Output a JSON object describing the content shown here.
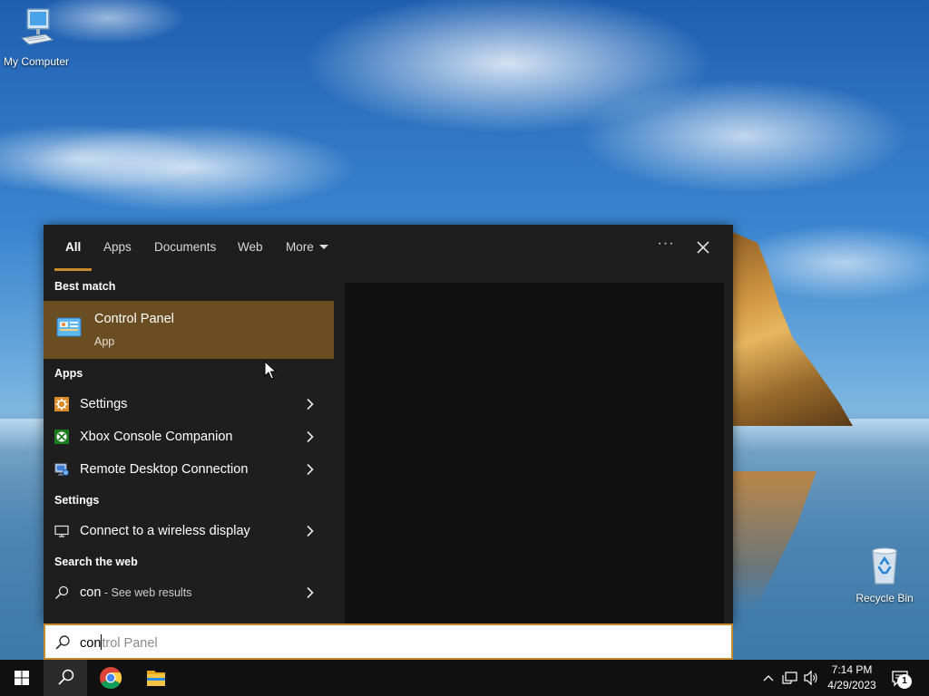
{
  "desktop": {
    "icons": [
      {
        "label": "My Computer",
        "icon": "computer-icon"
      },
      {
        "label": "Recycle Bin",
        "icon": "recycle-bin-icon"
      }
    ]
  },
  "search_panel": {
    "tabs": [
      {
        "label": "All",
        "active": true
      },
      {
        "label": "Apps"
      },
      {
        "label": "Documents"
      },
      {
        "label": "Web"
      },
      {
        "label": "More"
      }
    ],
    "options_label": "···",
    "best_match": {
      "header": "Best match",
      "title": "Control Panel",
      "subtitle": "App",
      "icon": "control-panel-icon",
      "highlight_color": "#6b4d22"
    },
    "apps": {
      "header": "Apps",
      "items": [
        {
          "label": "Settings",
          "icon": "settings-icon"
        },
        {
          "label": "Xbox Console Companion",
          "icon": "xbox-icon"
        },
        {
          "label": "Remote Desktop Connection",
          "icon": "remote-desktop-icon"
        }
      ]
    },
    "settings": {
      "header": "Settings",
      "items": [
        {
          "label": "Connect to a wireless display",
          "icon": "monitor-icon"
        }
      ]
    },
    "web": {
      "header": "Search the web",
      "query": "con",
      "suffix": " - See web results",
      "icon": "search-icon"
    }
  },
  "search_box": {
    "typed": "con",
    "suggestion": "trol Panel",
    "accent_color": "#c68a2c"
  },
  "taskbar": {
    "pinned": [
      "start-icon",
      "search-icon",
      "chrome-icon",
      "file-explorer-icon"
    ],
    "clock_time": "7:14 PM",
    "clock_date": "4/29/2023",
    "notification_count": "1"
  }
}
